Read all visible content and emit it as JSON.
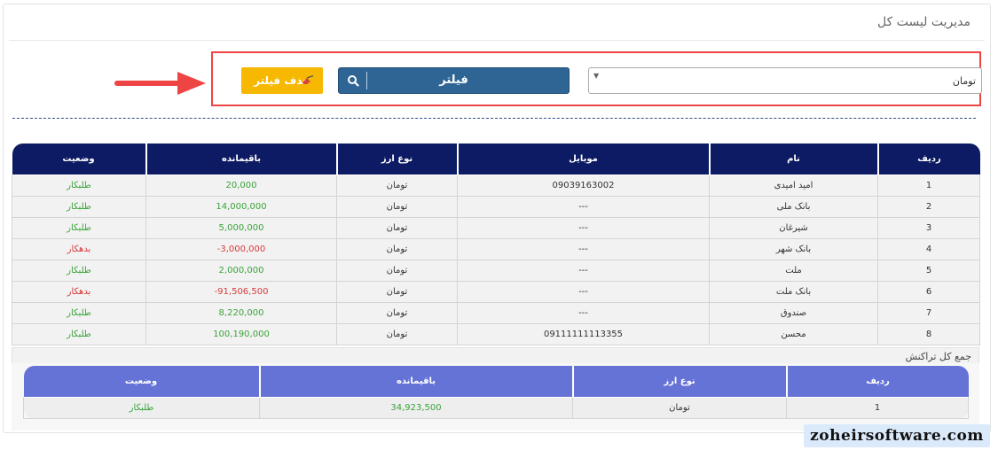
{
  "page_title": "مدیریت لیست کل",
  "filter": {
    "currency_select_value": "تومان",
    "filter_button_label": "فیلتر",
    "clear_button_label": "حذف فیلتر"
  },
  "colors": {
    "header_dark": "#0c1b63",
    "header_light": "#6673d6",
    "filter_button": "#2f6595",
    "clear_button": "#f6b800",
    "highlight_border": "#ee4444",
    "creditor": "#3aa33a",
    "debtor": "#d63a3a"
  },
  "icons": [
    "search-icon",
    "eraser-icon",
    "arrow-right-icon",
    "dropdown-caret-icon"
  ],
  "main_table": {
    "headers": {
      "row": "ردیف",
      "name": "نام",
      "mobile": "موبایل",
      "currency": "نوع ارز",
      "balance": "باقیمانده",
      "status": "وضعیت"
    },
    "rows": [
      {
        "row": "1",
        "name": "امید امیدی",
        "mobile": "09039163002",
        "currency": "تومان",
        "balance": "20,000",
        "status": "طلبکار"
      },
      {
        "row": "2",
        "name": "بانک ملی",
        "mobile": "---",
        "currency": "تومان",
        "balance": "14,000,000",
        "status": "طلبکار"
      },
      {
        "row": "3",
        "name": "شیرغان",
        "mobile": "---",
        "currency": "تومان",
        "balance": "5,000,000",
        "status": "طلبکار"
      },
      {
        "row": "4",
        "name": "بانک شهر",
        "mobile": "---",
        "currency": "تومان",
        "balance": "3,000,000-",
        "status": "بدهکار"
      },
      {
        "row": "5",
        "name": "ملت",
        "mobile": "---",
        "currency": "تومان",
        "balance": "2,000,000",
        "status": "طلبکار"
      },
      {
        "row": "6",
        "name": "بانک ملت",
        "mobile": "---",
        "currency": "تومان",
        "balance": "91,506,500-",
        "status": "بدهکار"
      },
      {
        "row": "7",
        "name": "صندوق",
        "mobile": "---",
        "currency": "تومان",
        "balance": "8,220,000",
        "status": "طلبکار"
      },
      {
        "row": "8",
        "name": "محسن",
        "mobile": "09111111113355",
        "currency": "تومان",
        "balance": "100,190,000",
        "status": "طلبکار"
      }
    ]
  },
  "summary": {
    "title": "جمع کل تراکنش",
    "headers": {
      "row": "ردیف",
      "currency": "نوع ارز",
      "balance": "باقیمانده",
      "status": "وضعیت"
    },
    "rows": [
      {
        "row": "1",
        "currency": "تومان",
        "balance": "34,923,500",
        "status": "طلبکار"
      }
    ]
  },
  "watermark": "zoheirsoftware.com"
}
